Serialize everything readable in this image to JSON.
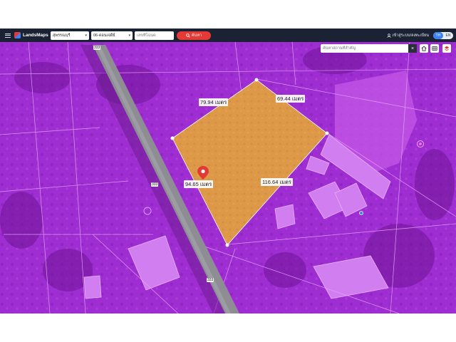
{
  "header": {
    "app_name": "LandsMaps",
    "province": "สุพรรณบุรี",
    "district": "06-ดอนเจดีย์",
    "parcel_placeholder": "เลขที่โฉนด",
    "search_label": "ค้นหา",
    "login_label": "เข้าสู่ระบบ/ลงทะเบียน",
    "lang_th": "TH",
    "lang_en": "EN"
  },
  "map": {
    "search_placeholder": "ค้นหาสถานที่สำคัญ",
    "road_label": "333",
    "measurements": {
      "top_left": "79.94 เมตร",
      "top_right": "69.44 เมตร",
      "left": "94.65 เมตร",
      "right": "116.64 เมตร"
    },
    "colors": {
      "overlay": "#a93ad9",
      "parcel": "#e7a13a",
      "pin": "#e53935",
      "search_button": "#e53935",
      "lang_active": "#3b82f6"
    },
    "icons": [
      "menu-icon",
      "search-icon",
      "user-icon",
      "close-icon",
      "home-icon",
      "grid-icon",
      "layers-icon",
      "location-pin-icon"
    ]
  }
}
